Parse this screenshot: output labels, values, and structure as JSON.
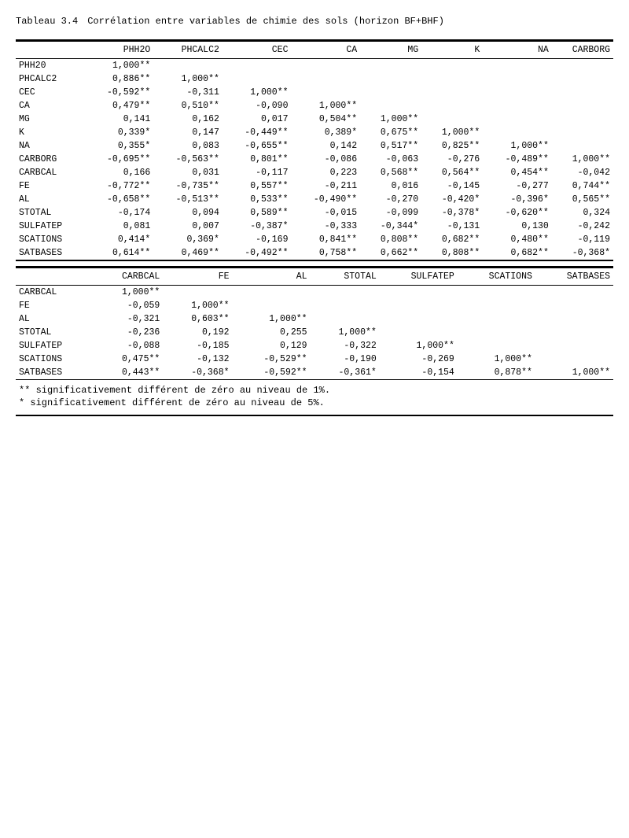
{
  "title": {
    "label": "Tableau 3.4",
    "text": "Corrélation entre variables de chimie des sols (horizon BF+BHF)"
  },
  "table1": {
    "headers": [
      "",
      "PHH2O",
      "PHCALC2",
      "CEC",
      "CA",
      "MG",
      "K",
      "NA",
      "CARBORG"
    ],
    "rows": [
      [
        "PHH20",
        "1,000**",
        "",
        "",
        "",
        "",
        "",
        "",
        ""
      ],
      [
        "PHCALC2",
        "0,886**",
        "1,000**",
        "",
        "",
        "",
        "",
        "",
        ""
      ],
      [
        "CEC",
        "-0,592**",
        "-0,311",
        "1,000**",
        "",
        "",
        "",
        "",
        ""
      ],
      [
        "CA",
        "0,479**",
        "0,510**",
        "-0,090",
        "1,000**",
        "",
        "",
        "",
        ""
      ],
      [
        "MG",
        "0,141",
        "0,162",
        "0,017",
        "0,504**",
        "1,000**",
        "",
        "",
        ""
      ],
      [
        "K",
        "0,339*",
        "0,147",
        "-0,449**",
        "0,389*",
        "0,675**",
        "1,000**",
        "",
        ""
      ],
      [
        "NA",
        "0,355*",
        "0,083",
        "-0,655**",
        "0,142",
        "0,517**",
        "0,825**",
        "1,000**",
        ""
      ],
      [
        "CARBORG",
        "-0,695**",
        "-0,563**",
        "0,801**",
        "-0,086",
        "-0,063",
        "-0,276",
        "-0,489**",
        "1,000**"
      ],
      [
        "CARBCAL",
        "0,166",
        "0,031",
        "-0,117",
        "0,223",
        "0,568**",
        "0,564**",
        "0,454**",
        "-0,042"
      ],
      [
        "FE",
        "-0,772**",
        "-0,735**",
        "0,557**",
        "-0,211",
        "0,016",
        "-0,145",
        "-0,277",
        "0,744**"
      ],
      [
        "AL",
        "-0,658**",
        "-0,513**",
        "0,533**",
        "-0,490**",
        "-0,270",
        "-0,420*",
        "-0,396*",
        "0,565**"
      ],
      [
        "STOTAL",
        "-0,174",
        "0,094",
        "0,589**",
        "-0,015",
        "-0,099",
        "-0,378*",
        "-0,620**",
        "0,324"
      ],
      [
        "SULFATEP",
        "0,081",
        "0,007",
        "-0,387*",
        "-0,333",
        "-0,344*",
        "-0,131",
        "0,130",
        "-0,242"
      ],
      [
        "SCATIONS",
        "0,414*",
        "0,369*",
        "-0,169",
        "0,841**",
        "0,808**",
        "0,682**",
        "0,480**",
        "-0,119"
      ],
      [
        "SATBASES",
        "0,614**",
        "0,469**",
        "-0,492**",
        "0,758**",
        "0,662**",
        "0,808**",
        "0,682**",
        "-0,368*"
      ]
    ]
  },
  "table2": {
    "headers": [
      "",
      "CARBCAL",
      "FE",
      "AL",
      "STOTAL",
      "SULFATEP",
      "SCATIONS",
      "SATBASES"
    ],
    "rows": [
      [
        "CARBCAL",
        "1,000**",
        "",
        "",
        "",
        "",
        "",
        ""
      ],
      [
        "FE",
        "-0,059",
        "1,000**",
        "",
        "",
        "",
        "",
        ""
      ],
      [
        "AL",
        "-0,321",
        "0,603**",
        "1,000**",
        "",
        "",
        "",
        ""
      ],
      [
        "STOTAL",
        "-0,236",
        "0,192",
        "0,255",
        "1,000**",
        "",
        "",
        ""
      ],
      [
        "SULFATEP",
        "-0,088",
        "-0,185",
        "0,129",
        "-0,322",
        "1,000**",
        "",
        ""
      ],
      [
        "SCATIONS",
        "0,475**",
        "-0,132",
        "-0,529**",
        "-0,190",
        "-0,269",
        "1,000**",
        ""
      ],
      [
        "SATBASES",
        "0,443**",
        "-0,368*",
        "-0,592**",
        "-0,361*",
        "-0,154",
        "0,878**",
        "1,000**"
      ]
    ]
  },
  "notes": [
    "** significativement différent de zéro au niveau de 1%.",
    " * significativement différent de zéro au niveau de 5%."
  ]
}
